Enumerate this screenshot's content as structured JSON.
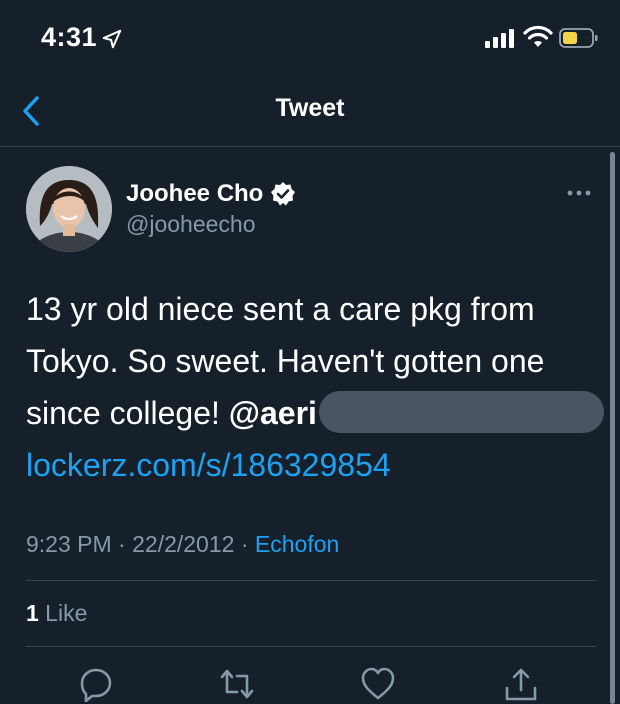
{
  "status_bar": {
    "time": "4:31",
    "icons": [
      "location-arrow-icon",
      "cellular-signal-icon",
      "wifi-icon",
      "battery-icon"
    ],
    "battery_color": "#f5d547"
  },
  "nav": {
    "title": "Tweet",
    "back_icon": "chevron-left-icon"
  },
  "author": {
    "display_name": "Joohee Cho",
    "handle": "@jooheecho",
    "verified": true
  },
  "tweet": {
    "line1": "13 yr old niece sent a care pkg from",
    "line2": "Tokyo. So sweet. Haven't gotten one",
    "line3_text": "since college! ",
    "mention": "@aeri",
    "link": "lockerz.com/s/186329854"
  },
  "meta": {
    "time": "9:23 PM",
    "sep1": " · ",
    "date": "22/2/2012",
    "sep2": " · ",
    "source": "Echofon"
  },
  "engagement": {
    "like_count": "1",
    "like_label": " Like"
  },
  "actions": [
    "reply-icon",
    "retweet-icon",
    "like-icon",
    "share-icon"
  ],
  "colors": {
    "background": "#15202b",
    "link": "#1da1f2",
    "secondary_text": "#8899a6",
    "divider": "#38444d"
  }
}
